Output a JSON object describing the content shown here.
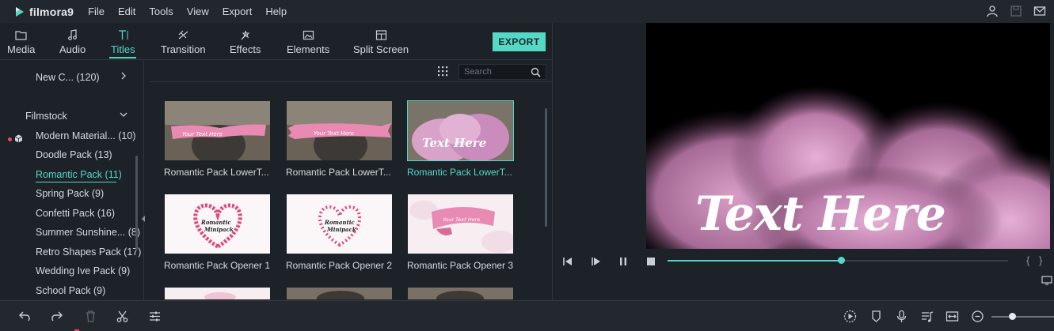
{
  "app": {
    "brand": "filmora9",
    "accent": "#55d8c6"
  },
  "menu": [
    "File",
    "Edit",
    "Tools",
    "View",
    "Export",
    "Help"
  ],
  "menubar_icons": [
    "user-icon",
    "save-icon",
    "mail-icon"
  ],
  "tabs": [
    {
      "label": "Media",
      "icon": "folder-icon"
    },
    {
      "label": "Audio",
      "icon": "music-note-icon"
    },
    {
      "label": "Titles",
      "icon": "text-icon",
      "active": true
    },
    {
      "label": "Transition",
      "icon": "transition-icon"
    },
    {
      "label": "Effects",
      "icon": "effects-icon"
    },
    {
      "label": "Elements",
      "icon": "image-icon"
    },
    {
      "label": "Split Screen",
      "icon": "split-screen-icon"
    }
  ],
  "export_label": "EXPORT",
  "sidebar": {
    "top_item": "New C... (120)",
    "group": "Filmstock",
    "items": [
      "Modern Material... (10)",
      "Doodle Pack (13)",
      "Romantic Pack (11)",
      "Spring Pack (9)",
      "Confetti Pack (16)",
      "Summer Sunshine... (8)",
      "Retro Shapes Pack (17)",
      "Wedding Ive Pack (9)",
      "School Pack (9)"
    ],
    "active_index": 2
  },
  "search": {
    "placeholder": "Search"
  },
  "cards": [
    {
      "label": "Romantic Pack LowerT...",
      "kind": "lower"
    },
    {
      "label": "Romantic Pack LowerT...",
      "kind": "lower2"
    },
    {
      "label": "Romantic Pack LowerT...",
      "kind": "selected"
    },
    {
      "label": "Romantic Pack Opener 1",
      "kind": "opener"
    },
    {
      "label": "Romantic Pack Opener 2",
      "kind": "opener"
    },
    {
      "label": "Romantic Pack Opener 3",
      "kind": "opener3"
    }
  ],
  "thumb_text": {
    "lower": "Your Text Here",
    "opener": "Romantic Minipack",
    "selected": "Text Here"
  },
  "preview": {
    "text": "Text Here",
    "progress": 0.51
  },
  "bottom_icons": [
    "undo-icon",
    "redo-icon",
    "delete-icon",
    "cut-icon",
    "adjust-icon",
    "render-icon",
    "marker-icon",
    "microphone-icon",
    "audio-mixer-icon",
    "fit-icon",
    "zoom-out-icon"
  ],
  "zoom_level": 0.33
}
